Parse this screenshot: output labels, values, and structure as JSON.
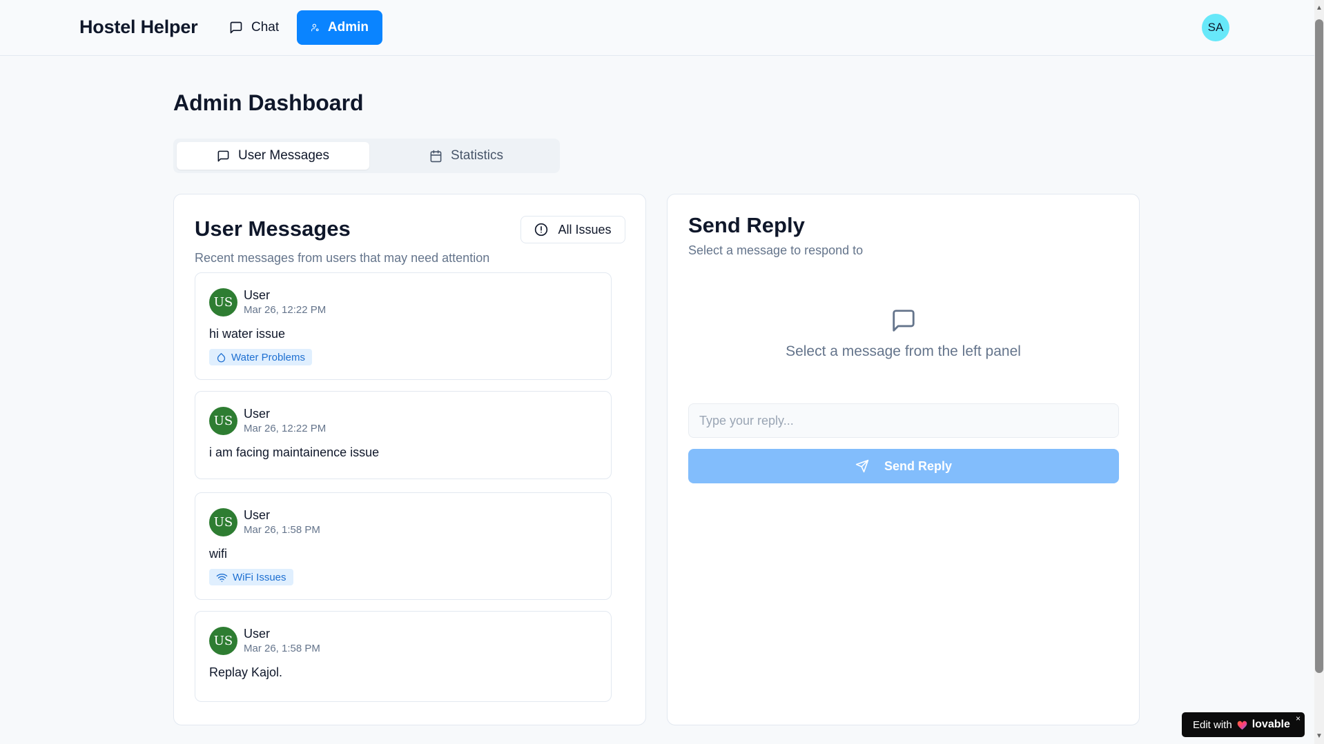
{
  "header": {
    "brand": "Hostel Helper",
    "nav": {
      "chat_label": "Chat",
      "admin_label": "Admin"
    },
    "user_initials": "SA"
  },
  "page": {
    "title": "Admin Dashboard",
    "tabs": [
      {
        "label": "User Messages",
        "icon": "message-square-icon",
        "active": true
      },
      {
        "label": "Statistics",
        "icon": "calendar-icon",
        "active": false
      }
    ]
  },
  "messages_panel": {
    "title": "User Messages",
    "subtitle": "Recent messages from users that may need attention",
    "filter_label": "All Issues",
    "messages": [
      {
        "initials": "US",
        "user": "User",
        "time": "Mar 26, 12:22 PM",
        "text": "hi water issue",
        "tag": "Water Problems",
        "tag_icon": "droplet-icon"
      },
      {
        "initials": "US",
        "user": "User",
        "time": "Mar 26, 12:22 PM",
        "text": "i am facing maintainence issue",
        "tag": null,
        "tag_icon": null
      },
      {
        "initials": "US",
        "user": "User",
        "time": "Mar 26, 1:58 PM",
        "text": "wifi",
        "tag": "WiFi Issues",
        "tag_icon": "wifi-icon"
      },
      {
        "initials": "US",
        "user": "User",
        "time": "Mar 26, 1:58 PM",
        "text": "Replay Kajol.",
        "tag": null,
        "tag_icon": null
      }
    ]
  },
  "reply_panel": {
    "title": "Send Reply",
    "subtitle": "Select a message to respond to",
    "empty_text": "Select a message from the left panel",
    "input_placeholder": "Type your reply...",
    "input_value": "",
    "send_label": "Send Reply"
  },
  "badge": {
    "prefix": "Edit with",
    "brand": "lovable",
    "close": "×"
  },
  "colors": {
    "accent": "#0a84ff",
    "send_disabled": "#82bdfc",
    "avatar_green": "#2e7d32",
    "tag_bg": "#e0effe",
    "tag_text": "#1d6fd1"
  }
}
